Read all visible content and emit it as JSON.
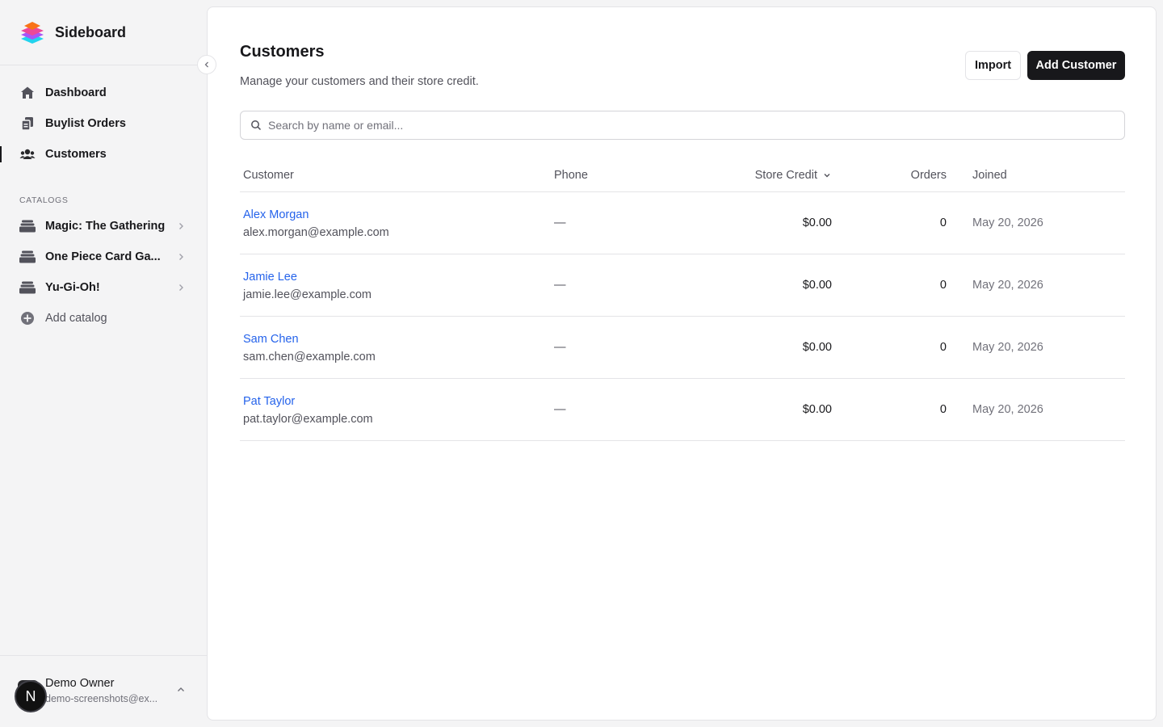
{
  "app": {
    "name": "Sideboard"
  },
  "sidebar": {
    "nav": [
      {
        "label": "Dashboard",
        "icon": "home-icon",
        "active": false
      },
      {
        "label": "Buylist Orders",
        "icon": "orders-icon",
        "active": false
      },
      {
        "label": "Customers",
        "icon": "users-icon",
        "active": true
      }
    ],
    "catalogs_label": "CATALOGS",
    "catalogs": [
      {
        "label": "Magic: The Gathering",
        "icon": "stack-icon"
      },
      {
        "label": "One Piece Card Ga...",
        "icon": "stack-icon"
      },
      {
        "label": "Yu-Gi-Oh!",
        "icon": "stack-icon"
      }
    ],
    "add_catalog": "Add catalog",
    "user": {
      "name": "Demo Owner",
      "email": "demo-screenshots@ex..."
    },
    "badge_letter": "N"
  },
  "page": {
    "title": "Customers",
    "subtitle": "Manage your customers and their store credit.",
    "import_label": "Import",
    "add_label": "Add Customer",
    "search_placeholder": "Search by name or email..."
  },
  "table": {
    "headers": {
      "customer": "Customer",
      "phone": "Phone",
      "credit": "Store Credit",
      "orders": "Orders",
      "joined": "Joined"
    },
    "rows": [
      {
        "name": "Alex Morgan",
        "email": "alex.morgan@example.com",
        "phone": "—",
        "credit": "$0.00",
        "orders": "0",
        "joined": "May 20, 2026"
      },
      {
        "name": "Jamie Lee",
        "email": "jamie.lee@example.com",
        "phone": "—",
        "credit": "$0.00",
        "orders": "0",
        "joined": "May 20, 2026"
      },
      {
        "name": "Sam Chen",
        "email": "sam.chen@example.com",
        "phone": "—",
        "credit": "$0.00",
        "orders": "0",
        "joined": "May 20, 2026"
      },
      {
        "name": "Pat Taylor",
        "email": "pat.taylor@example.com",
        "phone": "—",
        "credit": "$0.00",
        "orders": "0",
        "joined": "May 20, 2026"
      }
    ]
  },
  "colors": {
    "accent": "#18181b",
    "link": "#2563eb",
    "muted": "#71717a"
  }
}
